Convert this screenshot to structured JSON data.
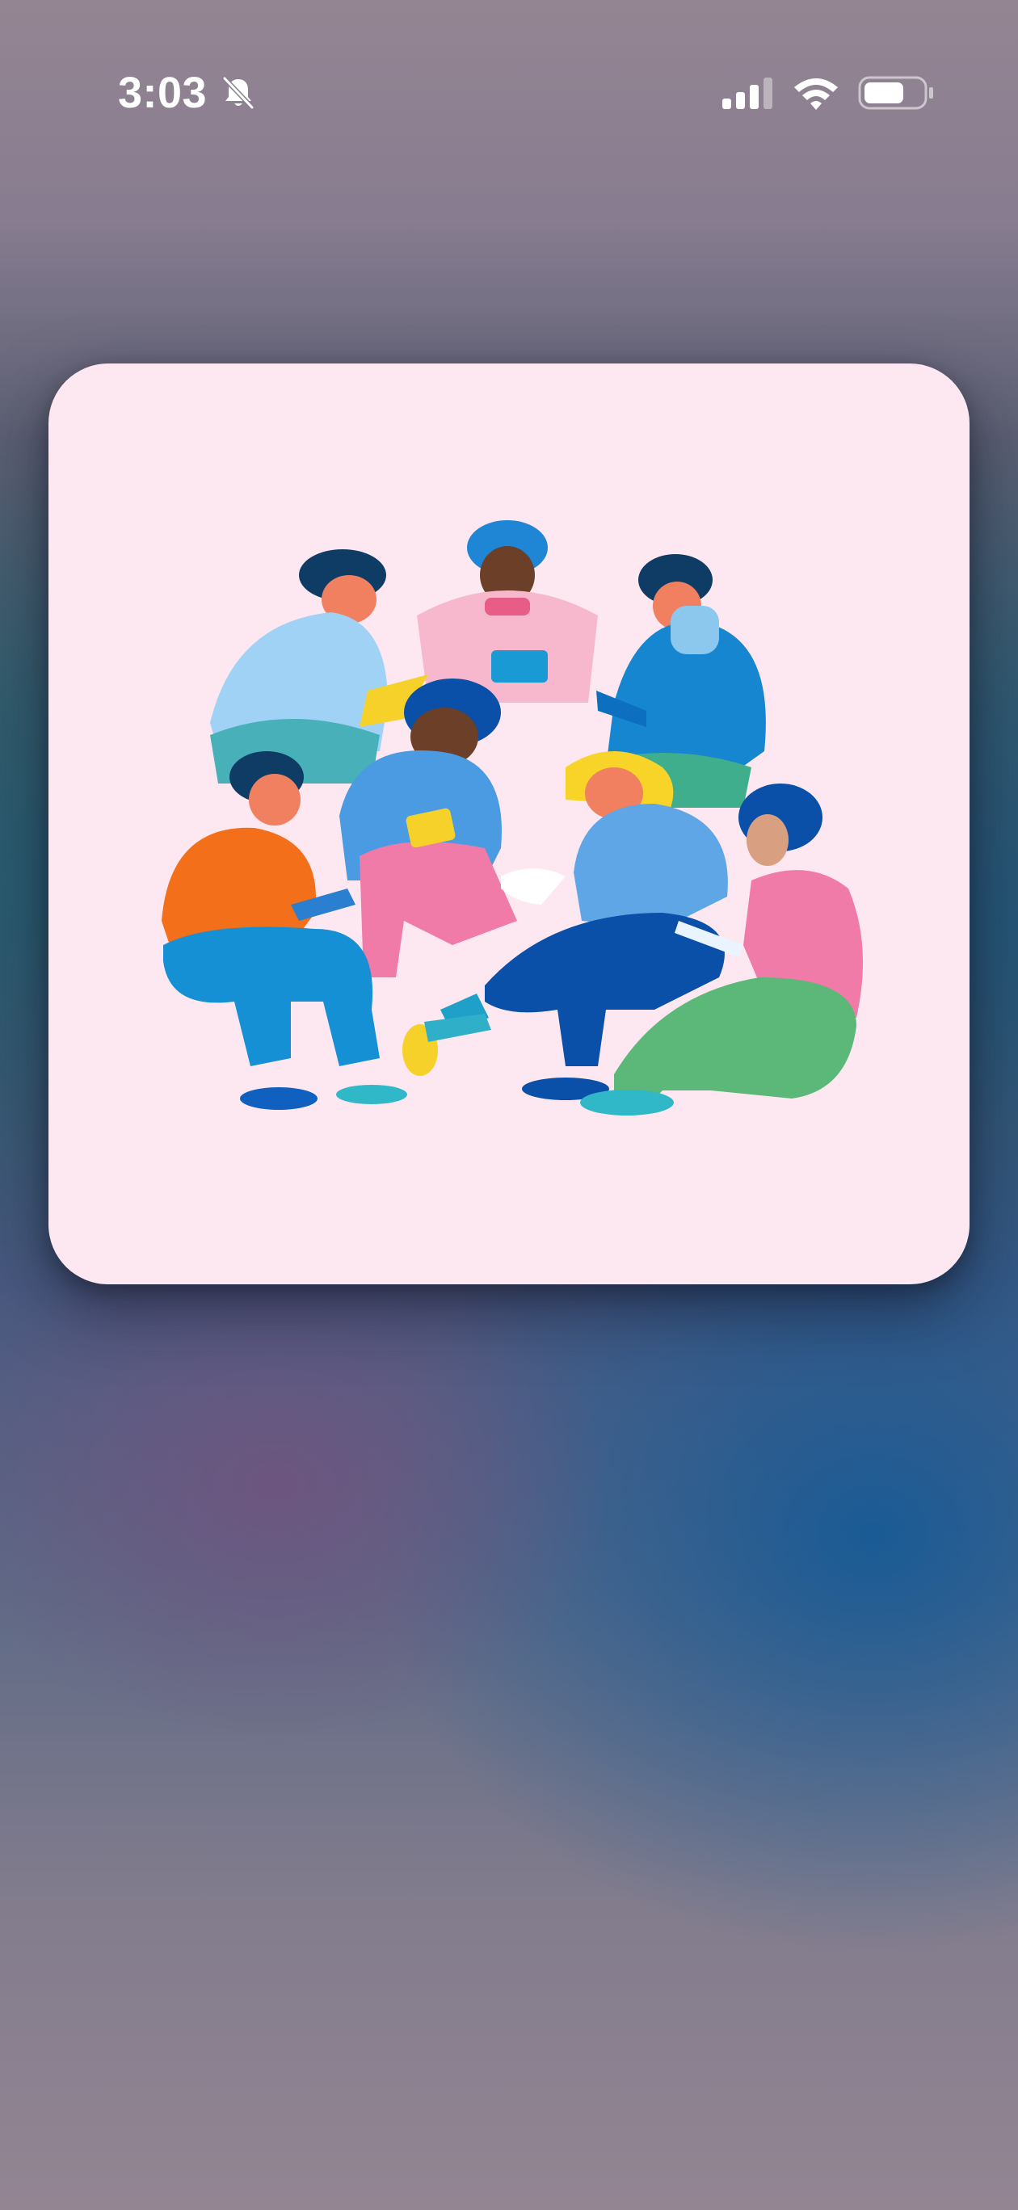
{
  "status_bar": {
    "time": "3:03",
    "silent_mode_icon": "bell-slash-icon",
    "signal_icon": "cellular-signal-icon",
    "wifi_icon": "wifi-icon",
    "battery_icon": "battery-icon"
  },
  "preview": {
    "image_description_icon": "people-writing-illustration",
    "card_background": "#fde8f2"
  },
  "colors": {
    "background_top": "#948592",
    "background_mid": "#3e5d6b",
    "background_blue": "#165a96",
    "background_purple": "#6e5580"
  }
}
